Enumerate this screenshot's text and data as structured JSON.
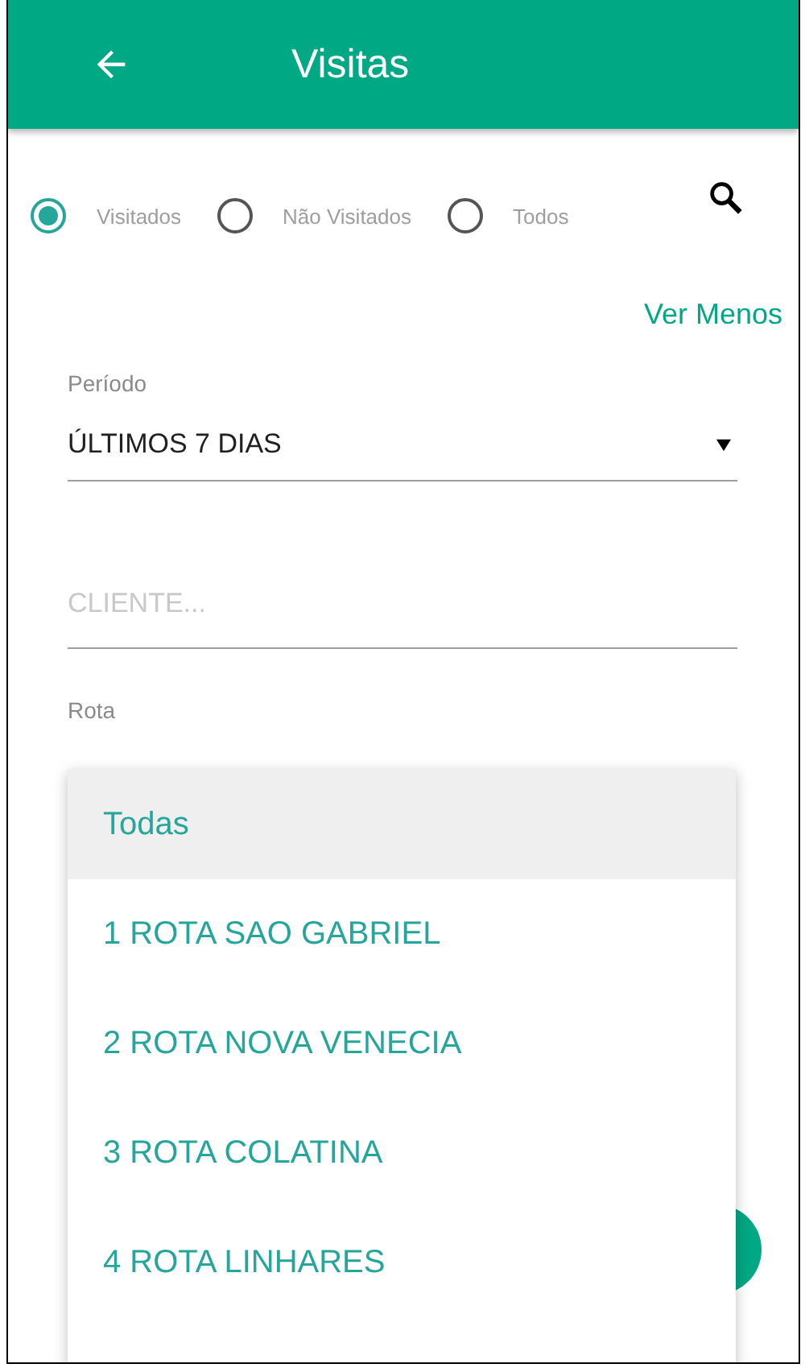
{
  "app_bar": {
    "title": "Visitas"
  },
  "filters": [
    {
      "label": "Visitados",
      "selected": true
    },
    {
      "label": "Não Visitados",
      "selected": false
    },
    {
      "label": "Todos",
      "selected": false
    }
  ],
  "toggle_link": "Ver Menos",
  "period": {
    "label": "Período",
    "value": "ÚLTIMOS 7 DIAS"
  },
  "client": {
    "placeholder": "CLIENTE..."
  },
  "route": {
    "label": "Rota"
  },
  "route_menu": [
    {
      "label": "Todas",
      "selected": true
    },
    {
      "label": "1 ROTA SAO GABRIEL",
      "selected": false
    },
    {
      "label": "2 ROTA NOVA VENECIA",
      "selected": false
    },
    {
      "label": "3 ROTA COLATINA",
      "selected": false
    },
    {
      "label": "4 ROTA LINHARES",
      "selected": false
    }
  ]
}
